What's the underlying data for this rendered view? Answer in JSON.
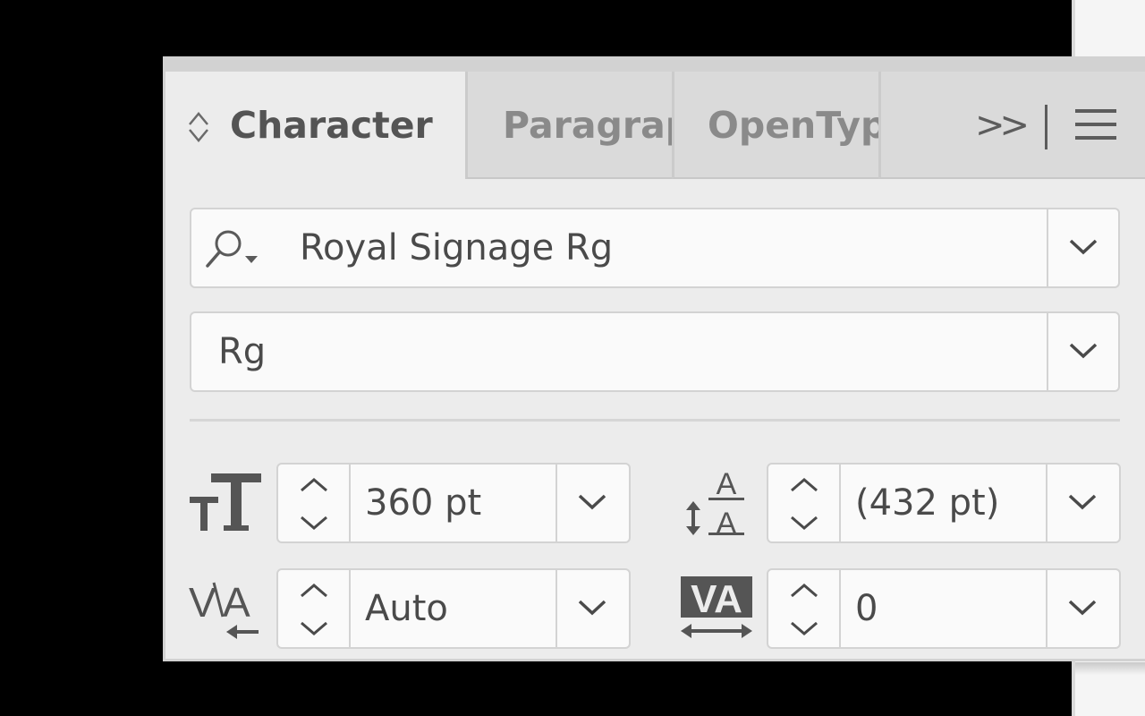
{
  "panel": {
    "tabs": [
      {
        "label": "Character",
        "active": true
      },
      {
        "label": "Paragraph",
        "active": false
      },
      {
        "label": "OpenType",
        "active": false
      }
    ],
    "overflow_label": ">>",
    "menu_icon": "hamburger-menu-icon"
  },
  "font_family": {
    "value": "Royal Signage Rg",
    "search_icon": "search-icon"
  },
  "font_style": {
    "value": "Rg"
  },
  "font_size": {
    "value": "360 pt",
    "icon": "font-size-icon"
  },
  "leading": {
    "value": "(432 pt)",
    "icon": "leading-icon"
  },
  "kerning": {
    "value": "Auto",
    "icon": "kerning-icon"
  },
  "tracking": {
    "value": "0",
    "icon": "tracking-icon"
  },
  "colors": {
    "panel_bg": "#ececec",
    "inactive_tab_bg": "#dadada",
    "field_bg": "#fafafa",
    "text": "#4a4a4a"
  }
}
